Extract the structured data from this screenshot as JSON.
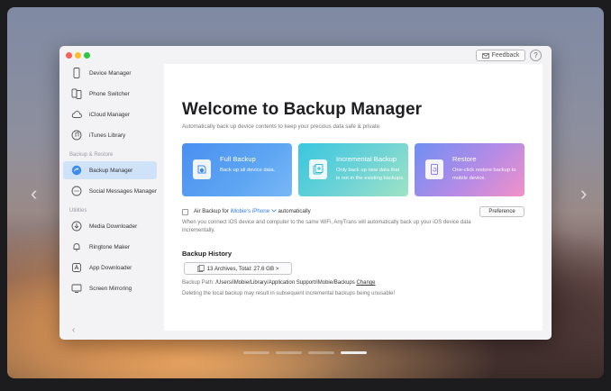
{
  "window": {
    "feedback_label": "Feedback",
    "help_label": "?"
  },
  "sidebar": {
    "items": [
      {
        "label": "Device Manager",
        "icon": "phone-icon"
      },
      {
        "label": "Phone Switcher",
        "icon": "phone-switch-icon"
      },
      {
        "label": "iCloud Manager",
        "icon": "cloud-icon"
      },
      {
        "label": "iTunes Library",
        "icon": "music-icon"
      },
      {
        "label": "Backup Manager",
        "icon": "backup-icon",
        "active": true
      },
      {
        "label": "Social Messages Manager",
        "icon": "chat-icon"
      },
      {
        "label": "Media Downloader",
        "icon": "download-icon"
      },
      {
        "label": "Ringtone Maker",
        "icon": "bell-icon"
      },
      {
        "label": "App Downloader",
        "icon": "app-icon"
      },
      {
        "label": "Screen Mirroring",
        "icon": "screen-icon"
      }
    ],
    "section_backup": "Backup & Restore",
    "section_utilities": "Utilities",
    "collapse_label": "‹"
  },
  "main": {
    "title": "Welcome to Backup Manager",
    "subtitle": "Automatically back up device contents to keep your precious data safe & private.",
    "cards": [
      {
        "title": "Full Backup",
        "desc": "Back up all device data."
      },
      {
        "title": "Incremental Backup",
        "desc": "Only back up new data that is not in the existing backups."
      },
      {
        "title": "Restore",
        "desc": "One-click restore backup to mobile device."
      }
    ],
    "air_backup_prefix": "Air Backup for ",
    "air_backup_device": "iMobie's iPhone",
    "air_backup_suffix": " automatically",
    "air_backup_checked": false,
    "preference_label": "Preference",
    "air_backup_desc": "When you connect iOS device and computer to the same WiFi, AnyTrans will automatically back up your iOS device data incrementally.",
    "history_title": "Backup History",
    "history_button": "13 Archives, Total: 27.6 GB >",
    "backup_path_label": "Backup Path: ",
    "backup_path_value": "/Users/iMobie/Library/Application Support/iMobie/Backups",
    "change_label": "Change",
    "warning": "Deleting the local backup may result in subsequent incremental backups being unusable!"
  },
  "carousel": {
    "prev_label": "‹",
    "next_label": "›",
    "page_count": 4,
    "active_page": 4
  },
  "colors": {
    "accent": "#2f7ef2",
    "active_item_bg": "#cfe2f7"
  }
}
